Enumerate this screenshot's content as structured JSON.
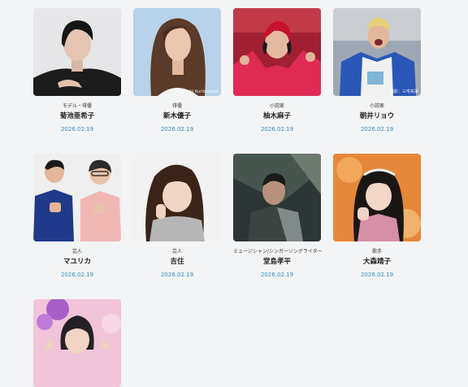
{
  "cards": [
    {
      "occupation": "モデル・俳優",
      "name": "菊池亜希子",
      "date": "2026.02.19",
      "credit": "",
      "bg": "#e9e9ea"
    },
    {
      "occupation": "俳優",
      "name": "新木優子",
      "date": "2026.02.19",
      "credit": "©Satoshi Kuribayashi",
      "bg": "#b9d3ea"
    },
    {
      "occupation": "小説家",
      "name": "柚木麻子",
      "date": "2026.02.19",
      "credit": "",
      "bg": "#b0243a"
    },
    {
      "occupation": "小説家",
      "name": "朝井リョウ",
      "date": "2026.02.19",
      "credit": "撮影：三宅祐事",
      "bg": "#9aa6b5"
    },
    {
      "occupation": "芸人",
      "name": "マユリカ",
      "date": "2026.02.19",
      "credit": "",
      "bg": "#eeeeee"
    },
    {
      "occupation": "芸人",
      "name": "吉住",
      "date": "2026.02.19",
      "credit": "",
      "bg": "#f1f1f1"
    },
    {
      "occupation": "ミュージシャン/シンガーソングライター",
      "name": "堂島孝平",
      "date": "2026.02.19",
      "credit": "",
      "bg": "#2f3a3a"
    },
    {
      "occupation": "歌手",
      "name": "大森靖子",
      "date": "2026.02.19",
      "credit": "",
      "bg": "#e98a3a"
    },
    {
      "occupation": "",
      "name": "",
      "date": "",
      "credit": "",
      "bg": "#f2c8de"
    }
  ]
}
